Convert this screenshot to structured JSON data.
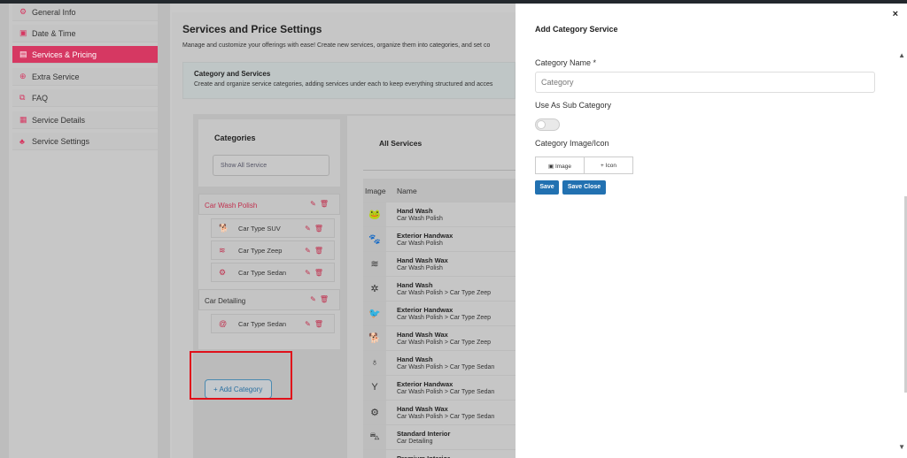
{
  "sidebar": {
    "items": [
      {
        "label": "General Info",
        "icon": "gear-icon",
        "glyph": "⚙"
      },
      {
        "label": "Date & Time",
        "icon": "calendar-icon",
        "glyph": "▣"
      },
      {
        "label": "Services & Pricing",
        "icon": "pricing-icon",
        "glyph": "▤"
      },
      {
        "label": "Extra Service",
        "icon": "extra-service-icon",
        "glyph": "⊕"
      },
      {
        "label": "FAQ",
        "icon": "faq-icon",
        "glyph": "⧉"
      },
      {
        "label": "Service Details",
        "icon": "details-icon",
        "glyph": "▦"
      },
      {
        "label": "Service Settings",
        "icon": "settings-people-icon",
        "glyph": "♣"
      }
    ],
    "active_index": 2,
    "accent": "#d63862"
  },
  "page": {
    "title": "Services and Price Settings",
    "description": "Manage and customize your offerings with ease! Create new services, organize them into categories, and set co"
  },
  "info": {
    "title": "Category and Services",
    "description": "Create and organize service categories, adding services under each to keep everything structured and acces"
  },
  "categories": {
    "title": "Categories",
    "show_all": "Show All Service",
    "items": [
      {
        "label": "Car Wash Polish",
        "subs": [
          {
            "label": "Car Type SUV",
            "icon": "dog-icon",
            "glyph": "🐕"
          },
          {
            "label": "Car Type Zeep",
            "icon": "water-icon",
            "glyph": "≋"
          },
          {
            "label": "Car Type Sedan",
            "icon": "bicycle-icon",
            "glyph": "⚙"
          }
        ]
      },
      {
        "label": "Car Detailing",
        "subs": [
          {
            "label": "Car Type Sedan",
            "icon": "snail-icon",
            "glyph": "@"
          }
        ]
      }
    ],
    "edit_glyph": "✎",
    "delete_glyph": "🗑",
    "add_label": "+ Add Category"
  },
  "services": {
    "title": "All Services",
    "columns": [
      "Image",
      "Name"
    ],
    "rows": [
      {
        "name": "Hand Wash",
        "category": "Car Wash Polish",
        "icon": "frog-icon",
        "glyph": "🐸"
      },
      {
        "name": "Exterior Handwax",
        "category": "Car Wash Polish",
        "icon": "paw-icon",
        "glyph": "🐾"
      },
      {
        "name": "Hand Wash Wax",
        "category": "Car Wash Polish",
        "icon": "water-icon",
        "glyph": "≋"
      },
      {
        "name": "Hand Wash",
        "category": "Car Wash Polish > Car Type Zeep",
        "icon": "spider-icon",
        "glyph": "✲"
      },
      {
        "name": "Exterior Handwax",
        "category": "Car Wash Polish > Car Type Zeep",
        "icon": "crow-icon",
        "glyph": "🐦"
      },
      {
        "name": "Hand Wash Wax",
        "category": "Car Wash Polish > Car Type Zeep",
        "icon": "dog-icon",
        "glyph": "🐕"
      },
      {
        "name": "Hand Wash",
        "category": "Car Wash Polish > Car Type Sedan",
        "icon": "microphone-icon",
        "glyph": "♁"
      },
      {
        "name": "Exterior Handwax",
        "category": "Car Wash Polish > Car Type Sedan",
        "icon": "cocktail-icon",
        "glyph": "Y"
      },
      {
        "name": "Hand Wash Wax",
        "category": "Car Wash Polish > Car Type Sedan",
        "icon": "tractor-icon",
        "glyph": "⚙"
      },
      {
        "name": "Standard Interior",
        "category": "Car Detailing",
        "icon": "car-icon",
        "glyph": "⛍"
      },
      {
        "name": "Premium Interior",
        "category": "",
        "icon": "cross-icon",
        "glyph": "✝"
      }
    ]
  },
  "modal": {
    "title": "Add Category Service",
    "close": "×",
    "name_label": "Category Name *",
    "name_placeholder": "Category",
    "sub_label": "Use As Sub Category",
    "image_label": "Category Image/Icon",
    "image_option": "Image",
    "icon_option": "+ Icon",
    "save": "Save",
    "save_close": "Save Close",
    "button_color": "#2271b1"
  }
}
